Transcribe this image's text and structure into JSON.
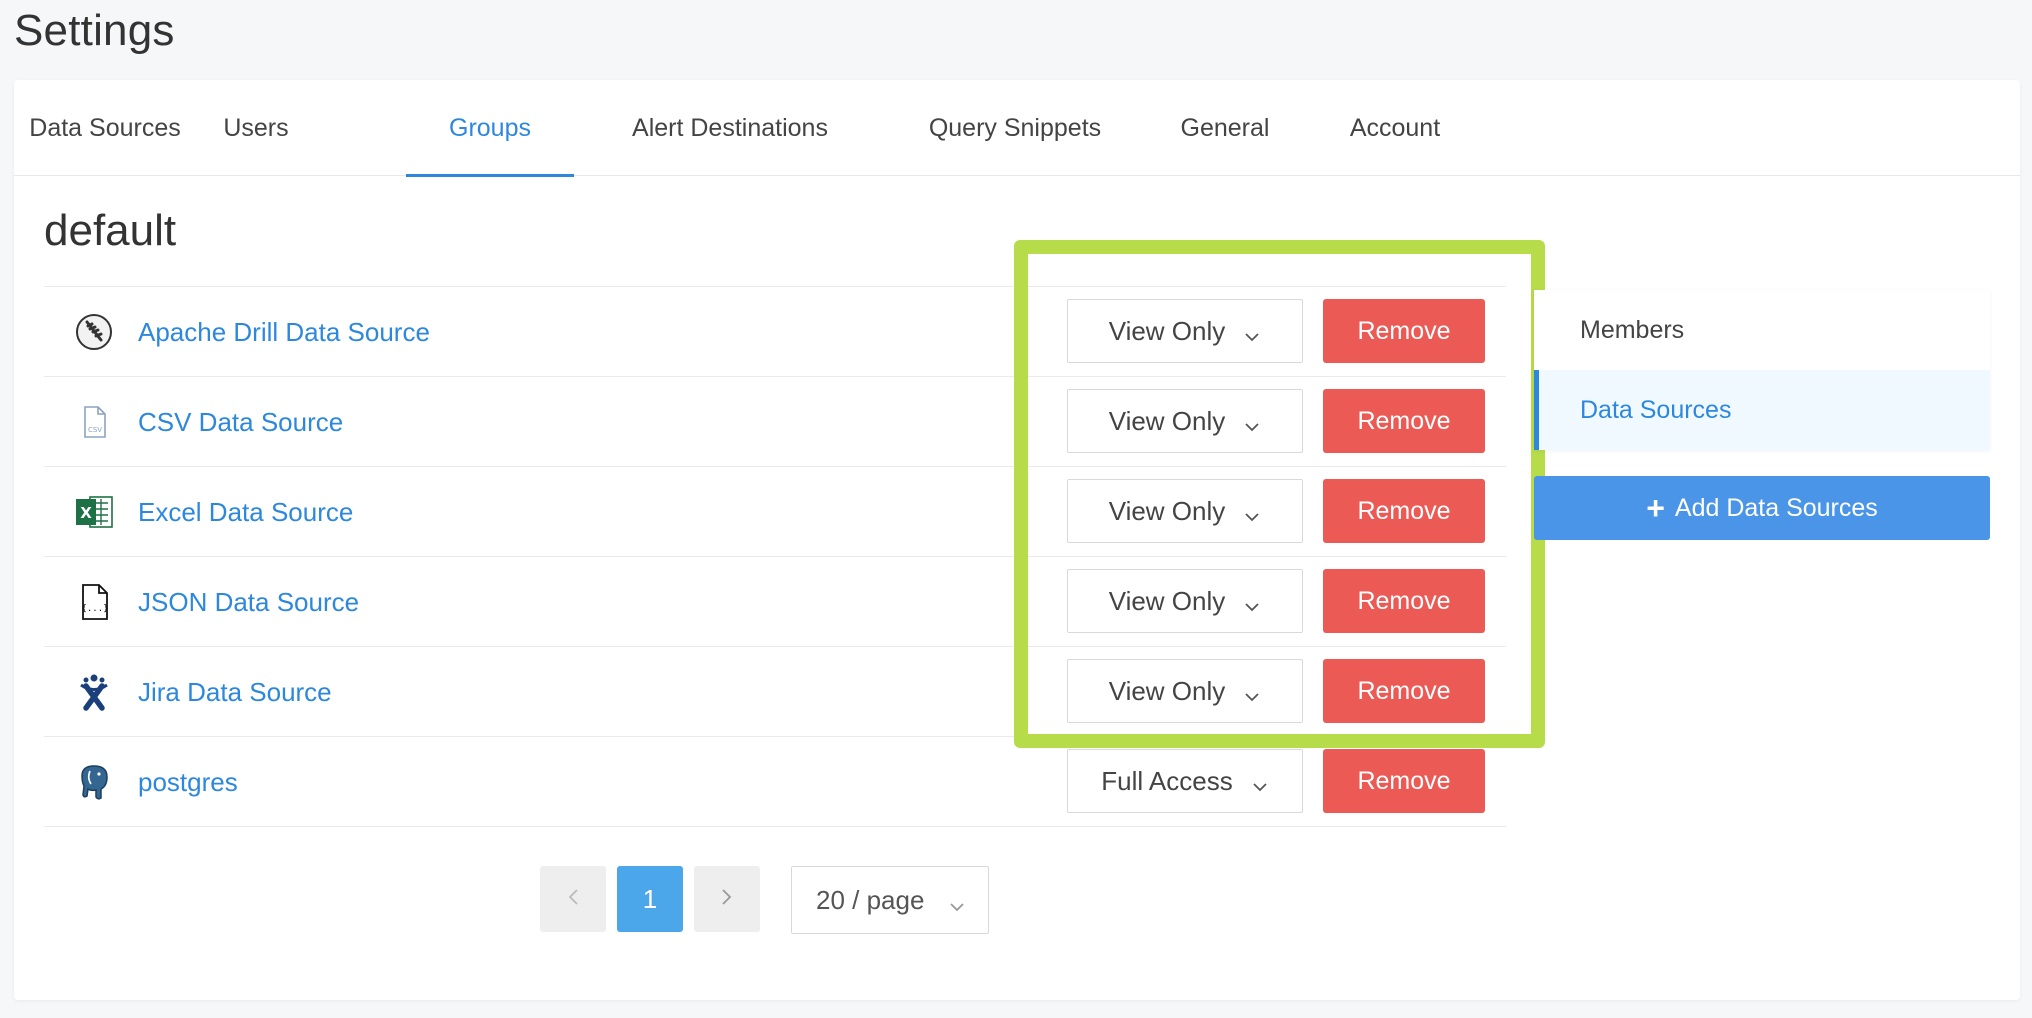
{
  "page": {
    "title": "Settings"
  },
  "tabs": [
    {
      "label": "Data Sources"
    },
    {
      "label": "Users"
    },
    {
      "label": "Groups"
    },
    {
      "label": "Alert Destinations"
    },
    {
      "label": "Query Snippets"
    },
    {
      "label": "General"
    },
    {
      "label": "Account"
    }
  ],
  "active_tab": "Groups",
  "group": {
    "name": "default"
  },
  "data_sources": [
    {
      "name": "Apache Drill Data Source",
      "icon": "apache-drill-icon",
      "permission": "View Only",
      "remove_label": "Remove"
    },
    {
      "name": "CSV Data Source",
      "icon": "csv-file-icon",
      "permission": "View Only",
      "remove_label": "Remove"
    },
    {
      "name": "Excel Data Source",
      "icon": "excel-icon",
      "permission": "View Only",
      "remove_label": "Remove"
    },
    {
      "name": "JSON Data Source",
      "icon": "json-file-icon",
      "permission": "View Only",
      "remove_label": "Remove"
    },
    {
      "name": "Jira Data Source",
      "icon": "jira-icon",
      "permission": "View Only",
      "remove_label": "Remove"
    },
    {
      "name": "postgres",
      "icon": "postgres-elephant-icon",
      "permission": "Full Access",
      "remove_label": "Remove"
    }
  ],
  "side_menu": {
    "items": [
      {
        "label": "Members"
      },
      {
        "label": "Data Sources"
      }
    ],
    "active": "Data Sources"
  },
  "add_button": {
    "label": "Add Data Sources",
    "icon": "plus-icon"
  },
  "pagination": {
    "current_page": "1",
    "page_size": "20 / page",
    "prev_icon": "chevron-left-icon",
    "next_icon": "chevron-right-icon"
  },
  "colors": {
    "accent": "#2d88dd",
    "danger": "#ec5a55",
    "highlight": "#b6dc4a",
    "primary_button": "#4a95e7"
  }
}
